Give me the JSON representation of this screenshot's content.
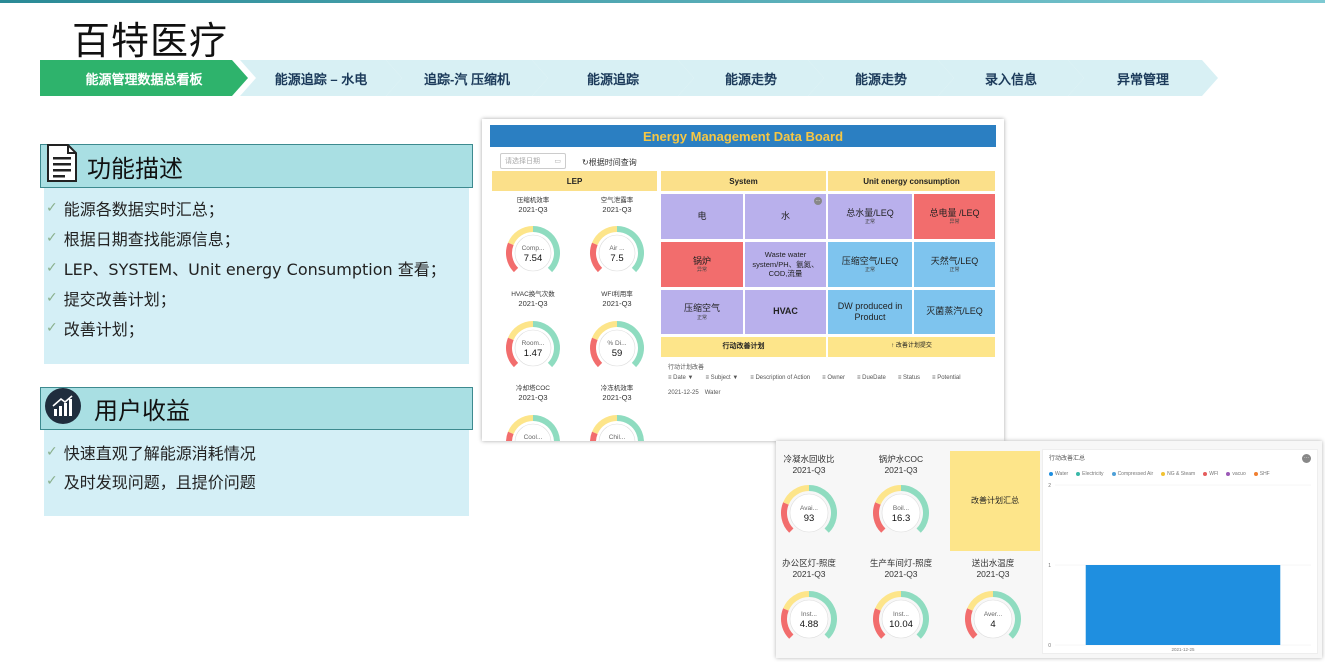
{
  "page_title": "百特医疗",
  "nav": [
    {
      "label": "能源管理数据总看板",
      "active": true
    },
    {
      "label": "能源追踪 – 水电",
      "active": false
    },
    {
      "label": "追踪-汽 压缩机",
      "active": false
    },
    {
      "label": "能源追踪",
      "active": false
    },
    {
      "label": "能源走势",
      "active": false
    },
    {
      "label": "能源走势",
      "active": false
    },
    {
      "label": "录入信息",
      "active": false
    },
    {
      "label": "异常管理",
      "active": false
    }
  ],
  "function_panel": {
    "heading": "功能描述",
    "icon": "document-icon",
    "items": [
      "能源各数据实时汇总；",
      "根据日期查找能源信息；",
      "LEP、SYSTEM、Unit energy Consumption 查看；",
      "提交改善计划；",
      "改善计划；"
    ]
  },
  "benefit_panel": {
    "heading": "用户收益",
    "icon": "growth-chart-icon",
    "items": [
      "快速直观了解能源消耗情况",
      "及时发现问题，且提价问题"
    ]
  },
  "dashboard": {
    "title": "Energy Management Data Board",
    "date_placeholder": "请选择日期",
    "date_query": "根据时间查询",
    "sections": {
      "lep": "LEP",
      "system": "System",
      "unit": "Unit energy consumption"
    },
    "lep_gauges": [
      {
        "name": "压缩机效率",
        "period": "2021-Q3",
        "short": "Comp...",
        "value": "7.54"
      },
      {
        "name": "空气泄露率",
        "period": "2021-Q3",
        "short": "Air ...",
        "value": "7.5"
      },
      {
        "name": "HVAC换气次数",
        "period": "2021-Q3",
        "short": "Room...",
        "value": "1.47"
      },
      {
        "name": "WFI利用率",
        "period": "2021-Q3",
        "short": "% Di...",
        "value": "59"
      },
      {
        "name": "冷却塔COC",
        "period": "2021-Q3",
        "short": "Cool...",
        "value": ""
      },
      {
        "name": "冷冻机效率",
        "period": "2021-Q3",
        "short": "Chil...",
        "value": ""
      }
    ],
    "system_tiles": [
      {
        "label": "电",
        "status": "",
        "color": "purple"
      },
      {
        "label": "水",
        "status": "",
        "color": "purple"
      },
      {
        "label": "锅炉",
        "status": "异常",
        "color": "red"
      },
      {
        "label": "Waste water system/PH、氨氮、COD,流量",
        "status": "",
        "color": "purple"
      },
      {
        "label": "压缩空气",
        "status": "正常",
        "color": "purple"
      },
      {
        "label": "HVAC",
        "status": "",
        "color": "purple"
      }
    ],
    "unit_tiles": [
      {
        "label": "总水量/LEQ",
        "status": "正常",
        "color": "purple"
      },
      {
        "label": "总电量 /LEQ",
        "status": "异常",
        "color": "red"
      },
      {
        "label": "压缩空气/LEQ",
        "status": "正常",
        "color": "blue"
      },
      {
        "label": "天然气/LEQ",
        "status": "正常",
        "color": "blue"
      },
      {
        "label": "DW produced in Product",
        "status": "",
        "color": "blue"
      },
      {
        "label": "灭菌蒸汽/LEQ",
        "status": "",
        "color": "blue"
      }
    ],
    "action_plan": "行动改善计划",
    "submit_plan": "改善计划提交",
    "plan_table_title": "行动计划改善",
    "plan_columns": [
      "Date",
      "Subject",
      "Description of Action",
      "Owner",
      "DueDate",
      "Status",
      "Potential"
    ],
    "plan_rows": [
      [
        "2021-12-25",
        "Water"
      ]
    ]
  },
  "dashboard2": {
    "gauges": [
      {
        "name": "冷凝水回收比",
        "period": "2021-Q3",
        "short": "Avai...",
        "value": "93"
      },
      {
        "name": "锅炉水COC",
        "period": "2021-Q3",
        "short": "Boil...",
        "value": "16.3"
      },
      {
        "name": "办公区灯-照度",
        "period": "2021-Q3",
        "short": "Inst...",
        "value": "4.88"
      },
      {
        "name": "生产车间灯-照度",
        "period": "2021-Q3",
        "short": "Inst...",
        "value": "10.04"
      },
      {
        "name": "送出水温度",
        "period": "2021-Q3",
        "short": "Aver...",
        "value": "4"
      }
    ],
    "summary_tile": "改善计划汇总",
    "chart_title": "行动改善汇总",
    "chart_data": {
      "type": "bar",
      "title": "行动改善汇总",
      "categories": [
        "2021-12-25"
      ],
      "series": [
        {
          "name": "Water",
          "values": [
            1
          ]
        },
        {
          "name": "Electricity",
          "values": [
            0
          ]
        },
        {
          "name": "Compressed Air",
          "values": [
            0
          ]
        },
        {
          "name": "NG & Steam",
          "values": [
            0
          ]
        },
        {
          "name": "WFI",
          "values": [
            0
          ]
        },
        {
          "name": "vacuo",
          "values": [
            0
          ]
        },
        {
          "name": "SHF",
          "values": [
            0
          ]
        }
      ],
      "ylim": [
        0,
        2
      ],
      "y_ticks": [
        "0",
        "1",
        "2"
      ],
      "legend_position": "top-left",
      "colors": [
        "#1f8fe0",
        "#39b8a8",
        "#4ea0d8",
        "#f1c232",
        "#e55c5c",
        "#9b59b6",
        "#f07f30"
      ]
    }
  }
}
